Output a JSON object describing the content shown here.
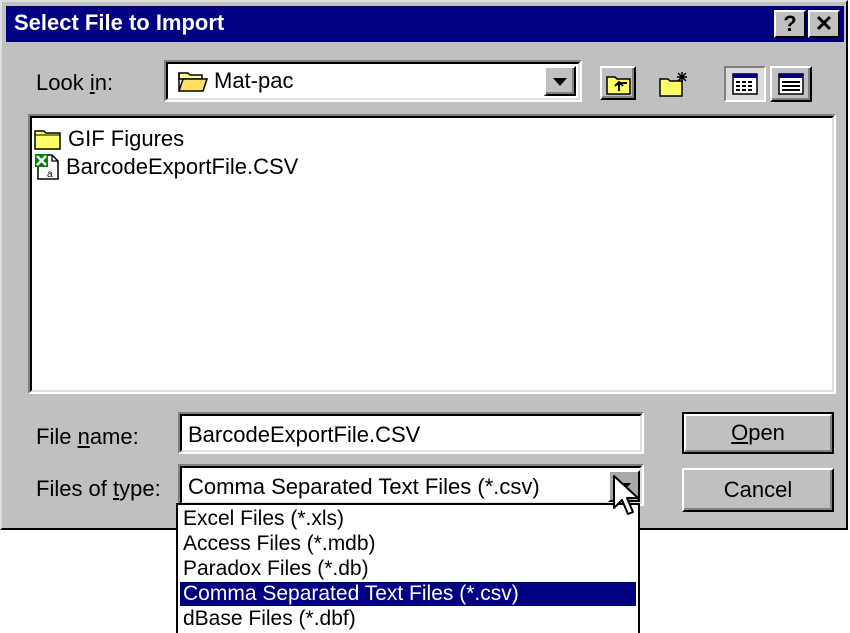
{
  "window": {
    "title": "Select File to Import",
    "help_btn": "?",
    "close_btn": "✕"
  },
  "look_in": {
    "label_pre": "Look ",
    "label_key": "i",
    "label_post": "n:",
    "value": "Mat-pac"
  },
  "files": [
    {
      "name": "GIF Figures",
      "icon": "folder-icon"
    },
    {
      "name": "BarcodeExportFile.CSV",
      "icon": "excel-csv-file-icon"
    }
  ],
  "file_name": {
    "label_pre": "File ",
    "label_key": "n",
    "label_post": "ame:",
    "value": "BarcodeExportFile.CSV"
  },
  "file_type": {
    "label_pre": "Files of ",
    "label_key": "t",
    "label_post": "ype:",
    "value": "Comma Separated Text Files (*.csv)",
    "options": [
      "Excel Files (*.xls)",
      "Access Files (*.mdb)",
      "Paradox Files (*.db)",
      "Comma Separated Text Files (*.csv)",
      "dBase Files (*.dbf)"
    ],
    "selected_index": 3
  },
  "buttons": {
    "open_key": "O",
    "open_rest": "pen",
    "cancel": "Cancel"
  },
  "colors": {
    "titlebar": "#000080",
    "face": "#c0c0c0",
    "selection": "#000080"
  }
}
